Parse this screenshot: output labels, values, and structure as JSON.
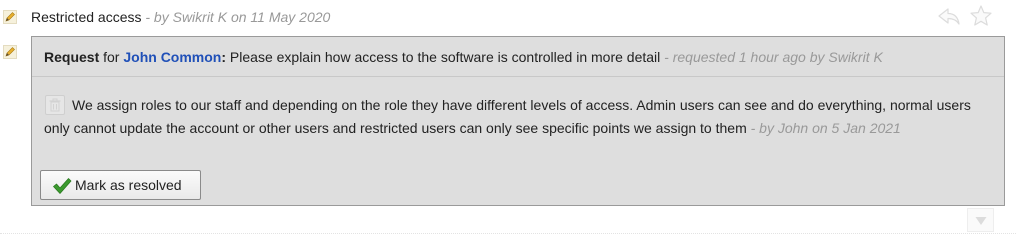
{
  "comment": {
    "title": "Restricted access",
    "meta": " - by Swikrit K on 11 May 2020"
  },
  "request": {
    "keyword": "Request",
    "for_text": " for ",
    "person": "John Common",
    "colon": ":",
    "question": " Please explain how access to the software is controlled in more detail",
    "meta": " - requested 1 hour ago by Swikrit K"
  },
  "reply": {
    "text": "We assign roles to our staff and depending on the role they have different levels of access. Admin users can see and do everything, normal users only cannot update the account or other users and restricted users can only see specific points we assign to them",
    "meta": " - by John on 5 Jan 2021"
  },
  "actions": {
    "resolve_label": "Mark as resolved"
  },
  "icons": {
    "edit": "pencil-icon",
    "reply": "reply-arrow-icon",
    "favorite": "star-icon",
    "delete": "trash-icon",
    "resolve": "checkmark-icon",
    "collapse": "triangle-down-icon"
  },
  "colors": {
    "person_link": "#2050b8",
    "meta_text": "#999999",
    "request_bg": "#dedede",
    "check_green": "#3b9a2e"
  }
}
